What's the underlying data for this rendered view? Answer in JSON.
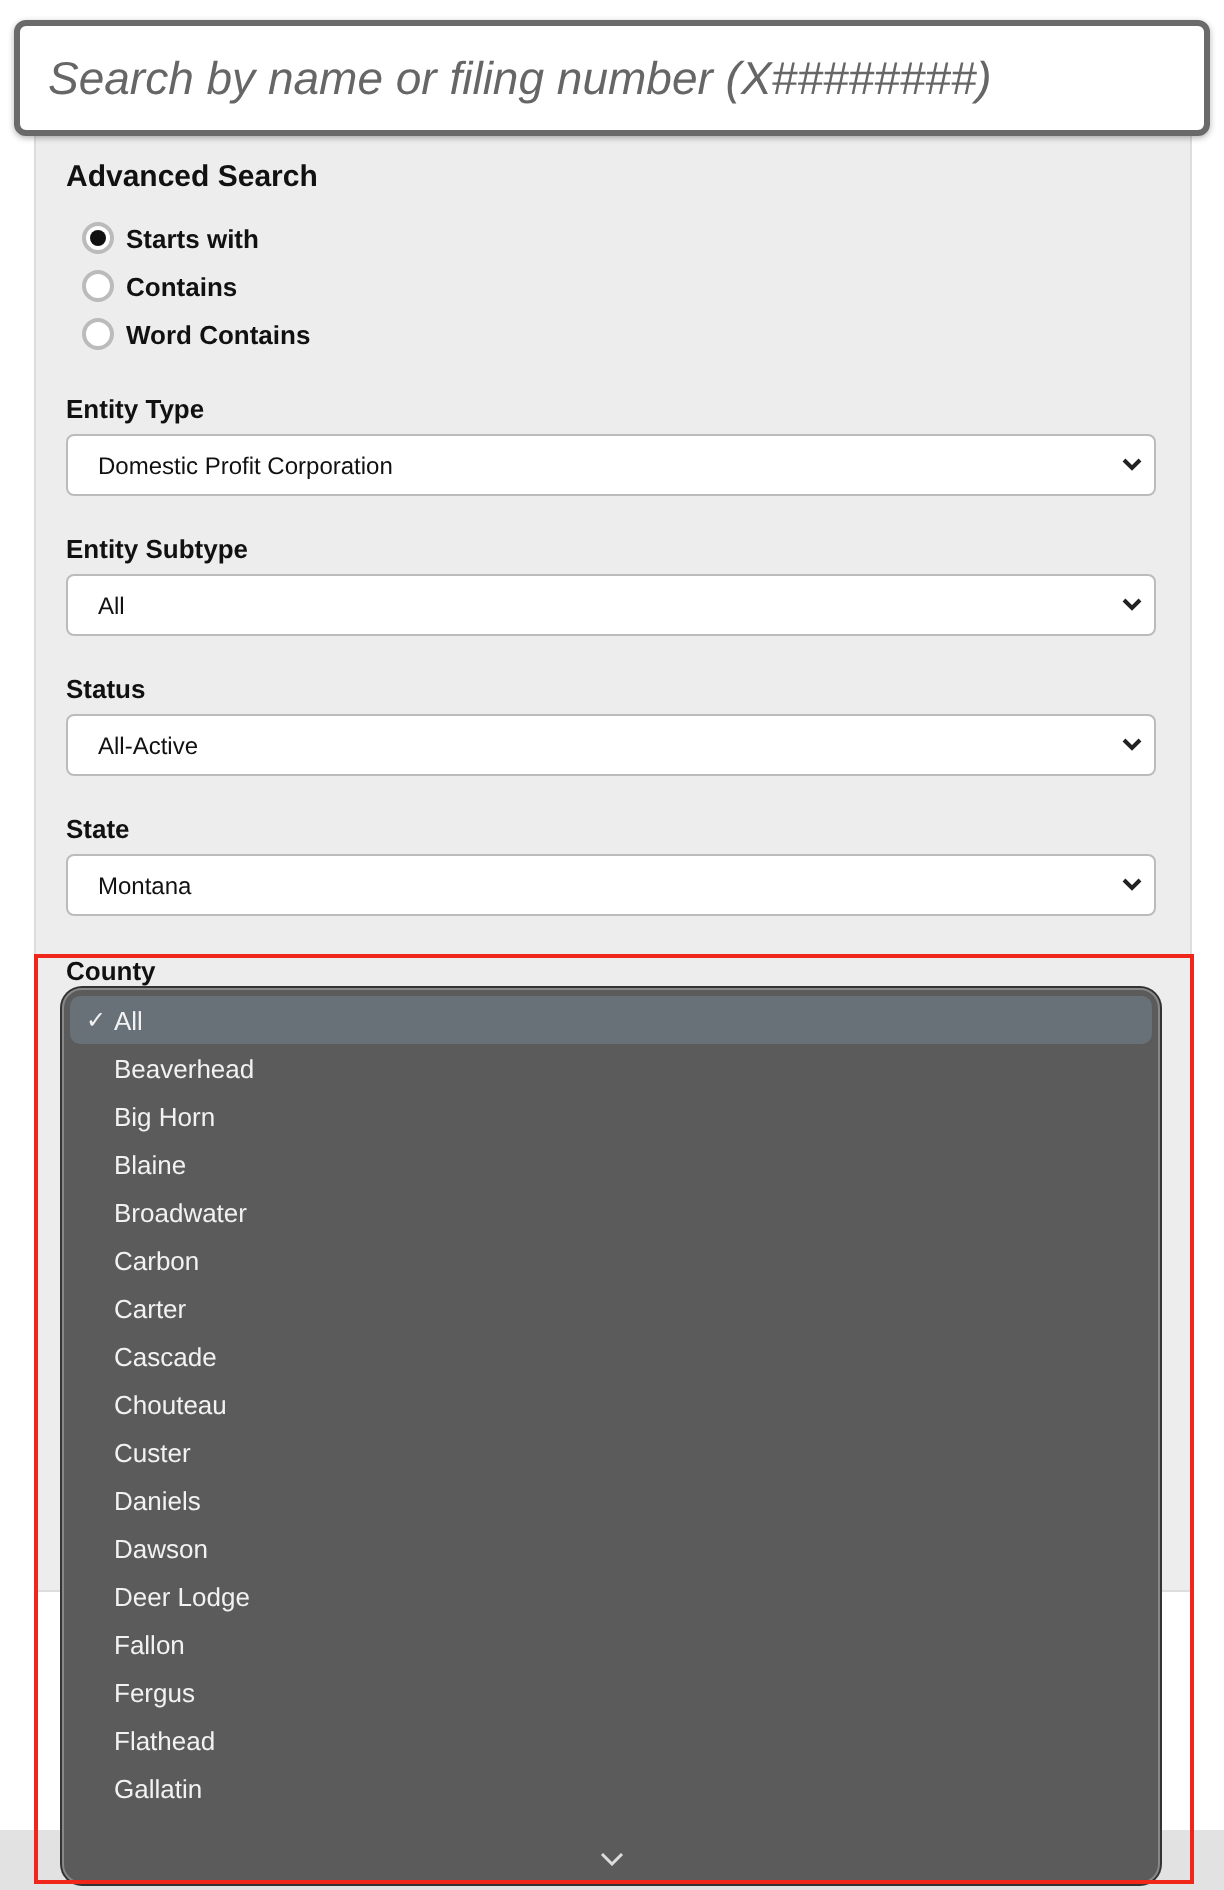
{
  "search": {
    "placeholder": "Search by name or filing number (X########)"
  },
  "advanced_search": {
    "title": "Advanced Search",
    "match_modes": [
      {
        "label": "Starts with",
        "selected": true
      },
      {
        "label": "Contains",
        "selected": false
      },
      {
        "label": "Word Contains",
        "selected": false
      }
    ],
    "filters": [
      {
        "label": "Entity Type",
        "value": "Domestic Profit Corporation"
      },
      {
        "label": "Entity Subtype",
        "value": "All"
      },
      {
        "label": "Status",
        "value": "All-Active"
      },
      {
        "label": "State",
        "value": "Montana"
      }
    ],
    "county": {
      "label": "County"
    }
  },
  "county_dropdown": {
    "options": [
      {
        "label": "All",
        "selected": true
      },
      {
        "label": "Beaverhead",
        "selected": false
      },
      {
        "label": "Big Horn",
        "selected": false
      },
      {
        "label": "Blaine",
        "selected": false
      },
      {
        "label": "Broadwater",
        "selected": false
      },
      {
        "label": "Carbon",
        "selected": false
      },
      {
        "label": "Carter",
        "selected": false
      },
      {
        "label": "Cascade",
        "selected": false
      },
      {
        "label": "Chouteau",
        "selected": false
      },
      {
        "label": "Custer",
        "selected": false
      },
      {
        "label": "Daniels",
        "selected": false
      },
      {
        "label": "Dawson",
        "selected": false
      },
      {
        "label": "Deer Lodge",
        "selected": false
      },
      {
        "label": "Fallon",
        "selected": false
      },
      {
        "label": "Fergus",
        "selected": false
      },
      {
        "label": "Flathead",
        "selected": false
      },
      {
        "label": "Gallatin",
        "selected": false
      }
    ],
    "check_mark": "✓"
  }
}
